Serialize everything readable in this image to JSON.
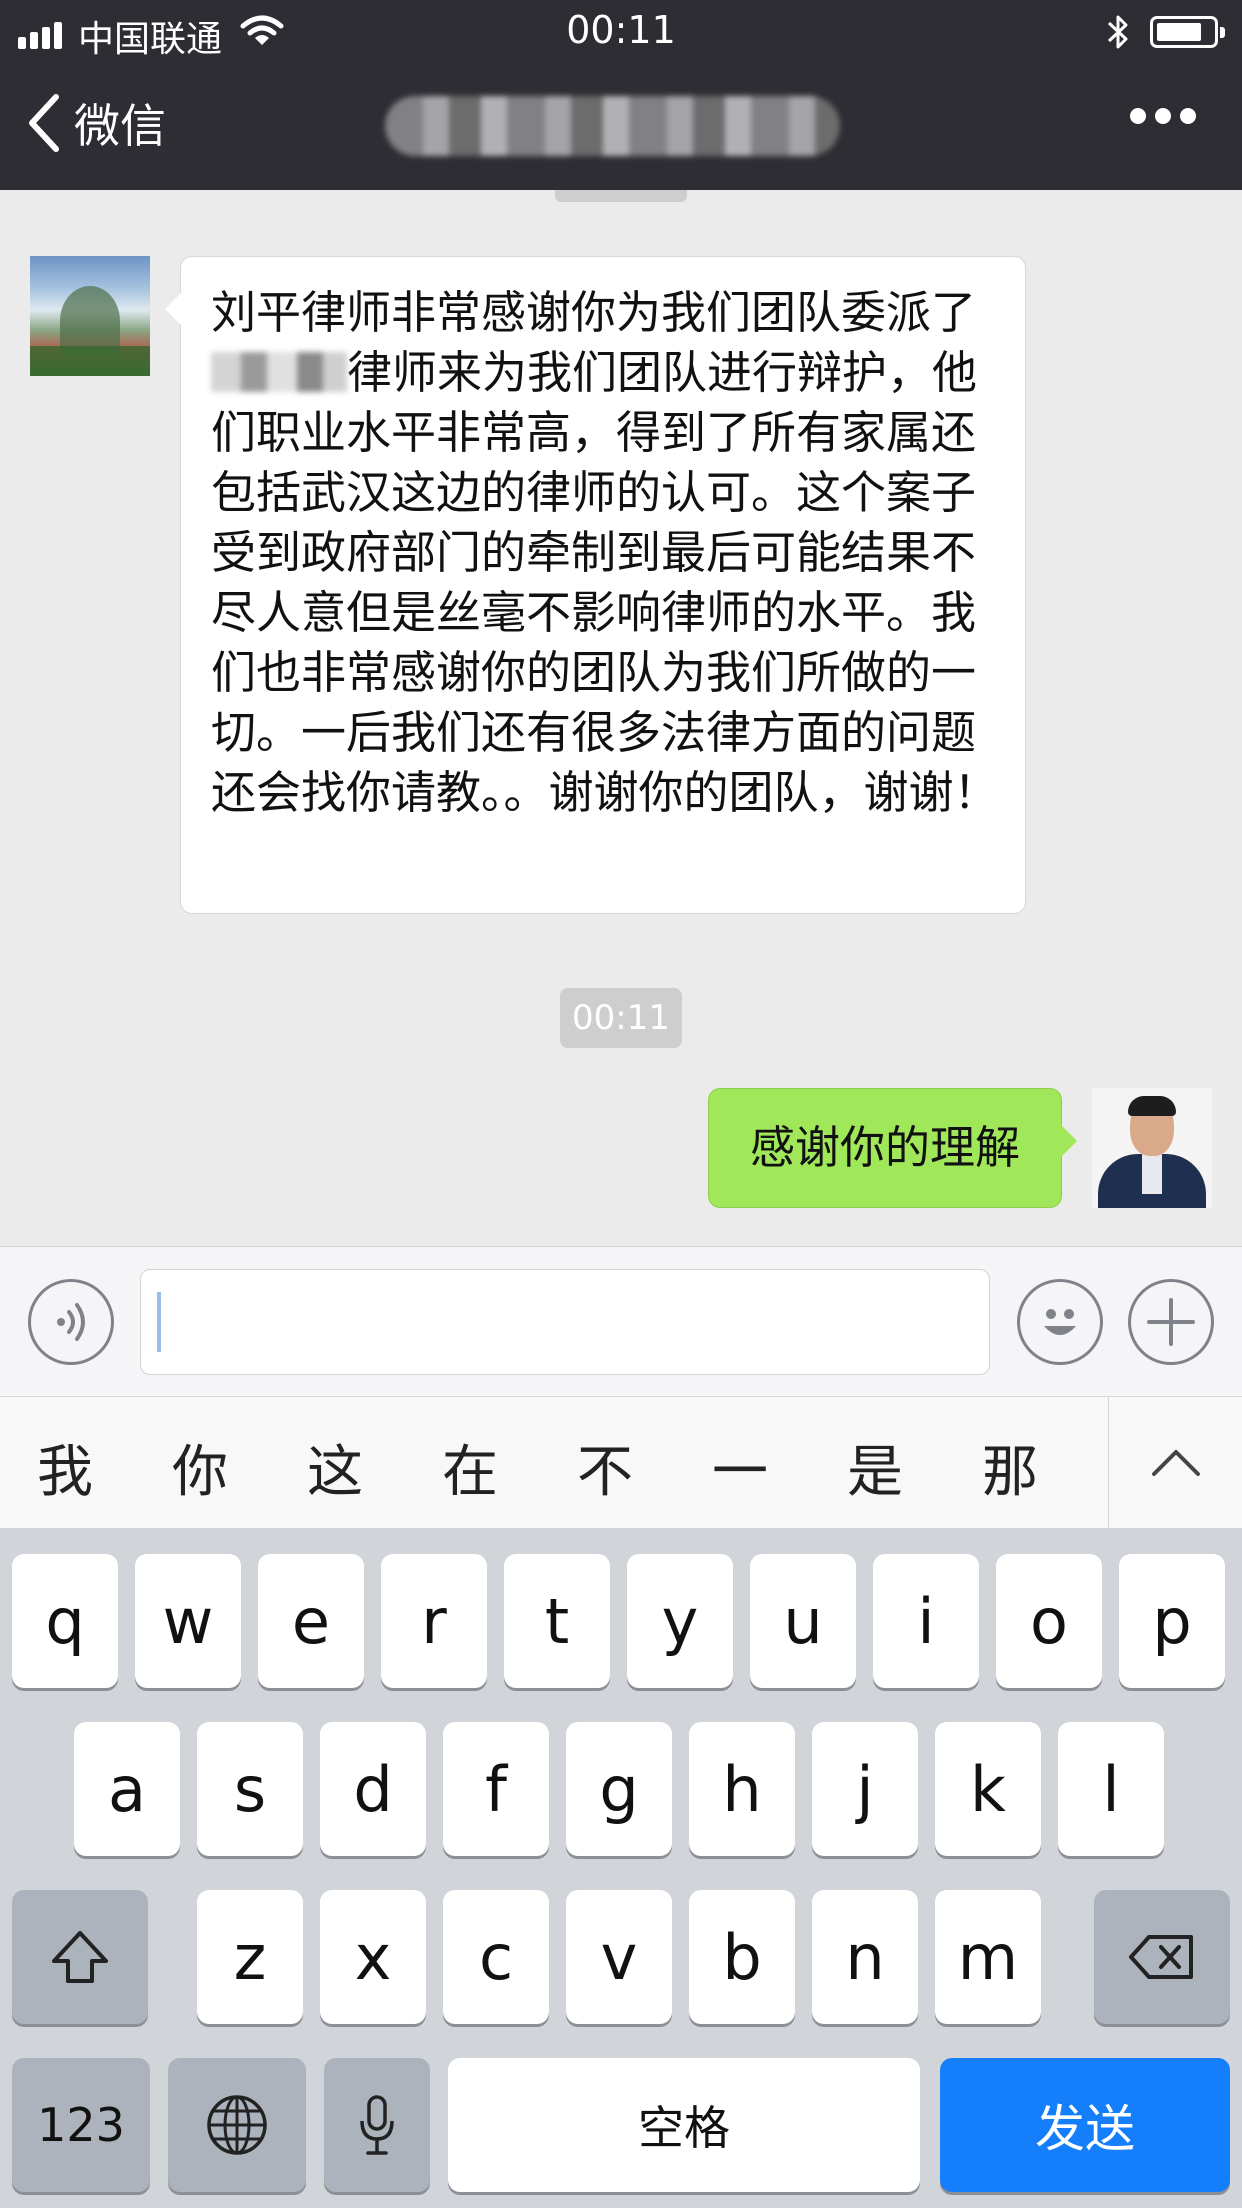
{
  "status_bar": {
    "carrier": "中国联通",
    "time": "00:11"
  },
  "nav": {
    "back_label": "微信"
  },
  "chat": {
    "messages": [
      {
        "side": "left",
        "text_part1": "刘平律师非常感谢你为我们团队委派了",
        "text_part2": "律师来为我们团队进行辩护，他们职业水平非常高，得到了所有家属还包括武汉这边的律师的认可。这个案子受到政府部门的牵制到最后可能结果不尽人意但是丝毫不影响律师的水平。我们也非常感谢你的团队为我们所做的一切。一后我们还有很多法律方面的问题还会找你请教。。谢谢你的团队，谢谢！"
      },
      {
        "side": "right",
        "text": "感谢你的理解"
      }
    ],
    "timestamp": "00:11"
  },
  "input": {
    "value": ""
  },
  "candidates": [
    "我",
    "你",
    "这",
    "在",
    "不",
    "一",
    "是",
    "那"
  ],
  "keyboard": {
    "row1": [
      "q",
      "w",
      "e",
      "r",
      "t",
      "y",
      "u",
      "i",
      "o",
      "p"
    ],
    "row2": [
      "a",
      "s",
      "d",
      "f",
      "g",
      "h",
      "j",
      "k",
      "l"
    ],
    "row3": [
      "z",
      "x",
      "c",
      "v",
      "b",
      "n",
      "m"
    ],
    "num_label": "123",
    "space_label": "空格",
    "send_label": "发送"
  },
  "colors": {
    "bar_bg": "#2e2d33",
    "chat_bg": "#ebebeb",
    "sent_bubble": "#a0e75a",
    "send_key": "#157efb"
  },
  "icons": [
    "signal-icon",
    "wifi-icon",
    "bluetooth-icon",
    "battery-icon",
    "chevron-left-icon",
    "more-dots-icon",
    "voice-icon",
    "emoji-icon",
    "plus-icon",
    "chevron-up-icon",
    "shift-icon",
    "delete-icon",
    "globe-icon",
    "microphone-icon"
  ]
}
